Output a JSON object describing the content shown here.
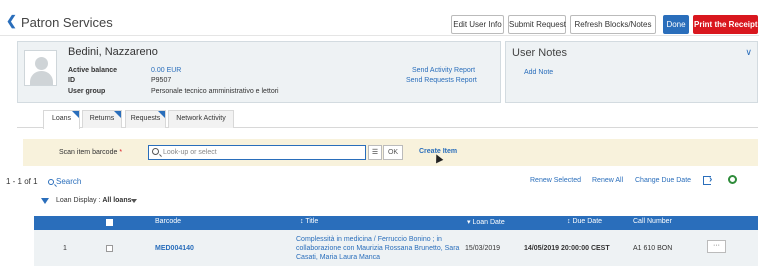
{
  "header": {
    "title": "Patron Services",
    "buttons": {
      "edit_user_info": "Edit User Info",
      "submit_request": "Submit Request",
      "refresh_blocks": "Refresh Blocks/Notes",
      "done": "Done",
      "print_receipt": "Print the Receipt"
    }
  },
  "patron": {
    "name": "Bedini, Nazzareno",
    "active_balance_label": "Active balance",
    "active_balance": "0.00 EUR",
    "id_label": "ID",
    "id": "P9507",
    "user_group_label": "User group",
    "user_group": "Personale tecnico amministrativo e lettori",
    "send_activity_report": "Send Activity Report",
    "send_requests_report": "Send Requests Report"
  },
  "user_notes": {
    "title": "User Notes",
    "add_note": "Add Note"
  },
  "tabs": [
    {
      "label": "Loans",
      "active": true
    },
    {
      "label": "Returns",
      "active": false
    },
    {
      "label": "Requests",
      "active": false
    },
    {
      "label": "Network Activity",
      "active": false
    }
  ],
  "scan": {
    "label": "Scan item barcode",
    "required_mark": "*",
    "placeholder": "Look-up or select",
    "ok": "OK",
    "create_item": "Create Item"
  },
  "results": {
    "count": "1 - 1 of 1",
    "search": "Search",
    "renew_selected": "Renew Selected",
    "renew_all": "Renew All",
    "change_due_date": "Change Due Date"
  },
  "loan_display": {
    "label": "Loan Display :",
    "value": "All loans"
  },
  "table": {
    "columns": {
      "barcode": "Barcode",
      "title": "Title",
      "loan_date": "Loan Date",
      "due_date": "Due Date",
      "call_number": "Call Number"
    },
    "rows": [
      {
        "index": "1",
        "barcode": "MED004140",
        "title": "Complessità in medicina / Ferruccio Bonino ; in collaborazione con Maurizia Rossana Brunetto, Sara Casati, Maria Laura Manca",
        "loan_date": "15/03/2019",
        "due_date": "14/05/2019 20:00:00 CEST",
        "call_number": "A1 610 BON",
        "more": "···"
      }
    ]
  }
}
